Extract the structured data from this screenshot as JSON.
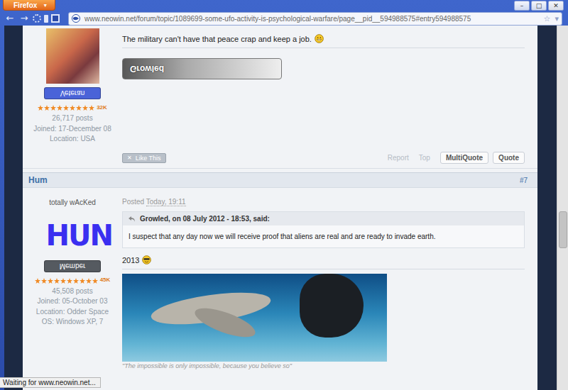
{
  "window": {
    "app_button": "Firefox",
    "app_arrow": "▼",
    "controls": [
      {
        "glyph": "–",
        "kind": "min"
      },
      {
        "glyph": "□",
        "kind": "max"
      },
      {
        "glyph": "✕",
        "kind": "close"
      }
    ]
  },
  "toolbar": {
    "nav": [
      "←",
      "→"
    ],
    "url": "www.neowin.net/forum/topic/1089699-some-ufo-activity-is-psychological-warfare/page__pid__594988575#entry594988575",
    "right": [
      "☆",
      "▾"
    ]
  },
  "scrollbar": {
    "level": 0.58
  },
  "posts": [
    {
      "badge": {
        "text": "Veteran",
        "color": "#4a63d8"
      },
      "rank": "32K",
      "stars": 9,
      "stats": [
        "26,717 posts",
        "Joined: 17-December 08",
        "Location: USA"
      ],
      "text": "The military can't have that peace crap and keep a job.",
      "emoji": "grin",
      "signature": {
        "kind": "banner",
        "text": "Growled"
      },
      "footer": {
        "like_icon": "✕",
        "like_label": "Like This",
        "links": [
          "Report",
          "Top"
        ],
        "buttons": [
          "MultiQuote",
          "Quote"
        ]
      }
    },
    {
      "header": {
        "author": "Hum",
        "number": "#7"
      },
      "user_title": "totally wAcKed",
      "avatar_text": "HUN",
      "badge": {
        "text": "Member",
        "color": "#555a60"
      },
      "rank": "45K",
      "stars": 10,
      "stats": [
        "45,508 posts",
        "Joined: 05-October 03",
        "Location: Odder Space",
        "OS: Windows XP, 7"
      ],
      "posted_label": "Posted",
      "posted_time": "Today, 19:11",
      "quote": {
        "author_line": "Growled, on 08 July 2012 - 18:53, said:",
        "text": "I suspect that any day now we will receive proof that aliens are real and are ready to invade earth."
      },
      "text": "2013",
      "emoji": "cool",
      "signature": {
        "kind": "photo",
        "caption": "\"The impossible is only impossible, because you believe so\""
      }
    }
  ],
  "status_bar": "Waiting for www.neowin.net..."
}
